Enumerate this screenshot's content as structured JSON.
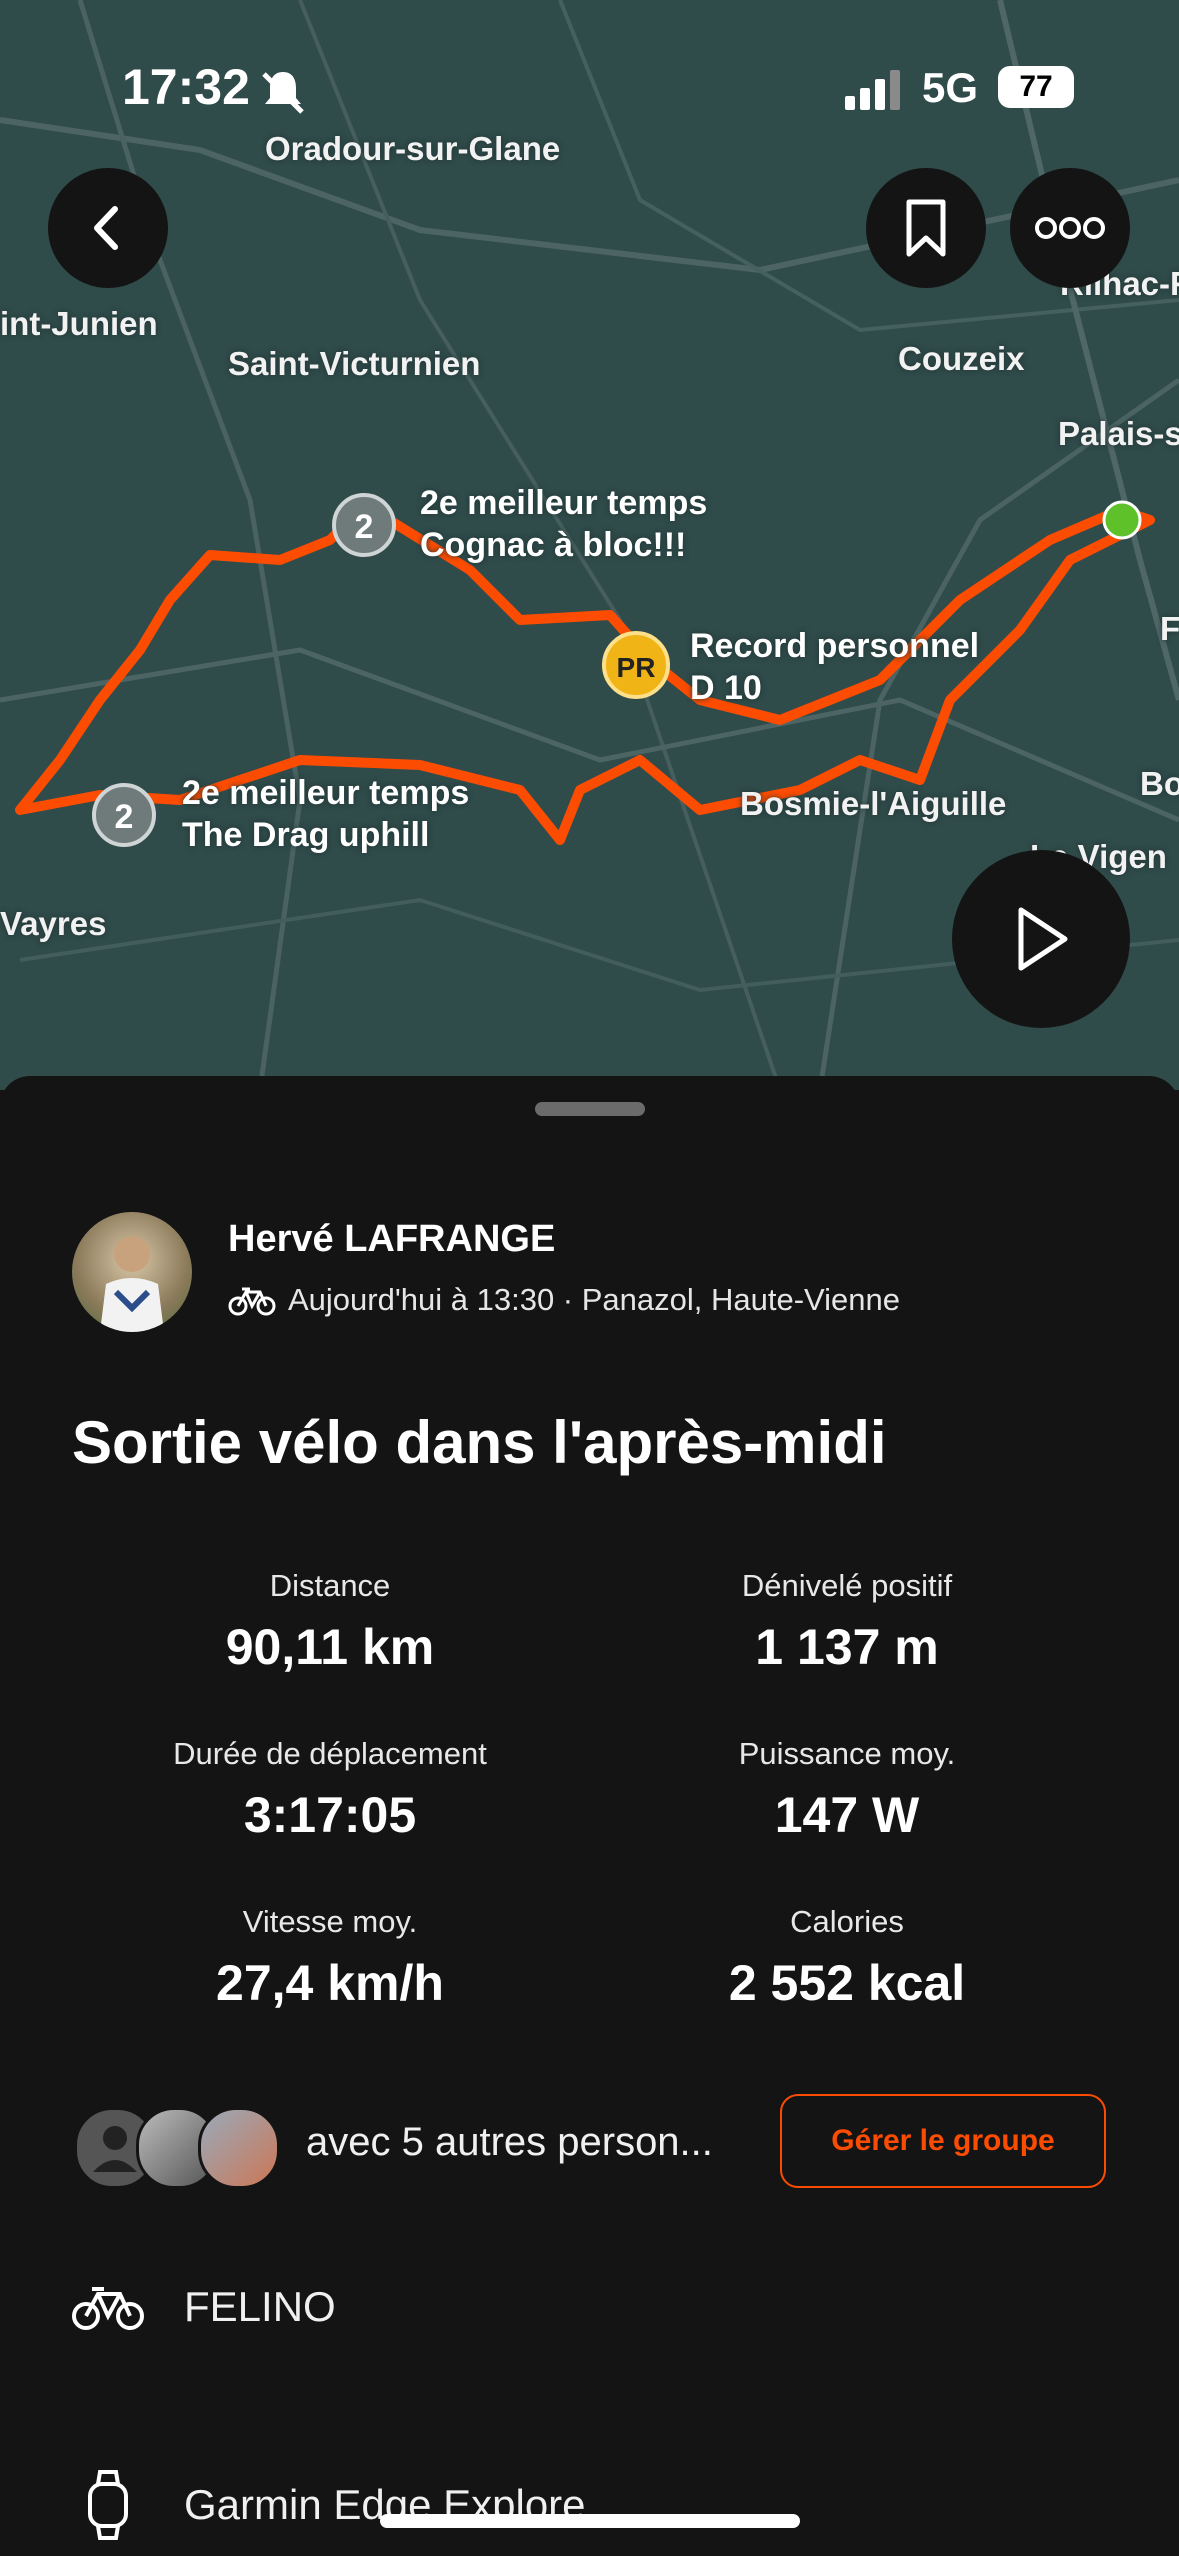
{
  "status_bar": {
    "time": "17:32",
    "network": "5G",
    "battery": "77"
  },
  "map": {
    "places": [
      "Oradour-sur-Glane",
      "int-Junien",
      "Saint-Victurnien",
      "Couzeix",
      "Palais-s",
      "Rilhac-R",
      "Vayres",
      "Bosmie-l'Aiguille",
      "Le Vigen",
      "F",
      "Bo"
    ],
    "segments": [
      {
        "badge": "2",
        "rank": "2e meilleur temps",
        "name": "Cognac à bloc!!!"
      },
      {
        "badge": "PR",
        "rank": "Record personnel",
        "name": "D 10"
      },
      {
        "badge": "2",
        "rank": "2e meilleur temps",
        "name": "The Drag uphill"
      }
    ],
    "route_color": "#fc4c02"
  },
  "activity": {
    "athlete": "Hervé LAFRANGE",
    "meta": "Aujourd'hui à 13:30 · Panazol, Haute-Vienne",
    "title": "Sortie vélo dans l'après-midi",
    "stats": [
      {
        "label": "Distance",
        "value": "90,11 km"
      },
      {
        "label": "Dénivelé positif",
        "value": "1 137 m"
      },
      {
        "label": "Durée de déplacement",
        "value": "3:17:05"
      },
      {
        "label": "Puissance moy.",
        "value": "147 W"
      },
      {
        "label": "Vitesse moy.",
        "value": "27,4 km/h"
      },
      {
        "label": "Calories",
        "value": "2 552 kcal"
      }
    ],
    "group_text": "avec 5 autres person...",
    "manage_group": "Gérer le groupe",
    "bike": "FELINO",
    "device": "Garmin Edge Explore"
  },
  "icons": [
    "back-icon",
    "bookmark-icon",
    "more-icon",
    "play-icon",
    "bike-icon",
    "watch-icon"
  ],
  "accent_color": "#fc4c02"
}
